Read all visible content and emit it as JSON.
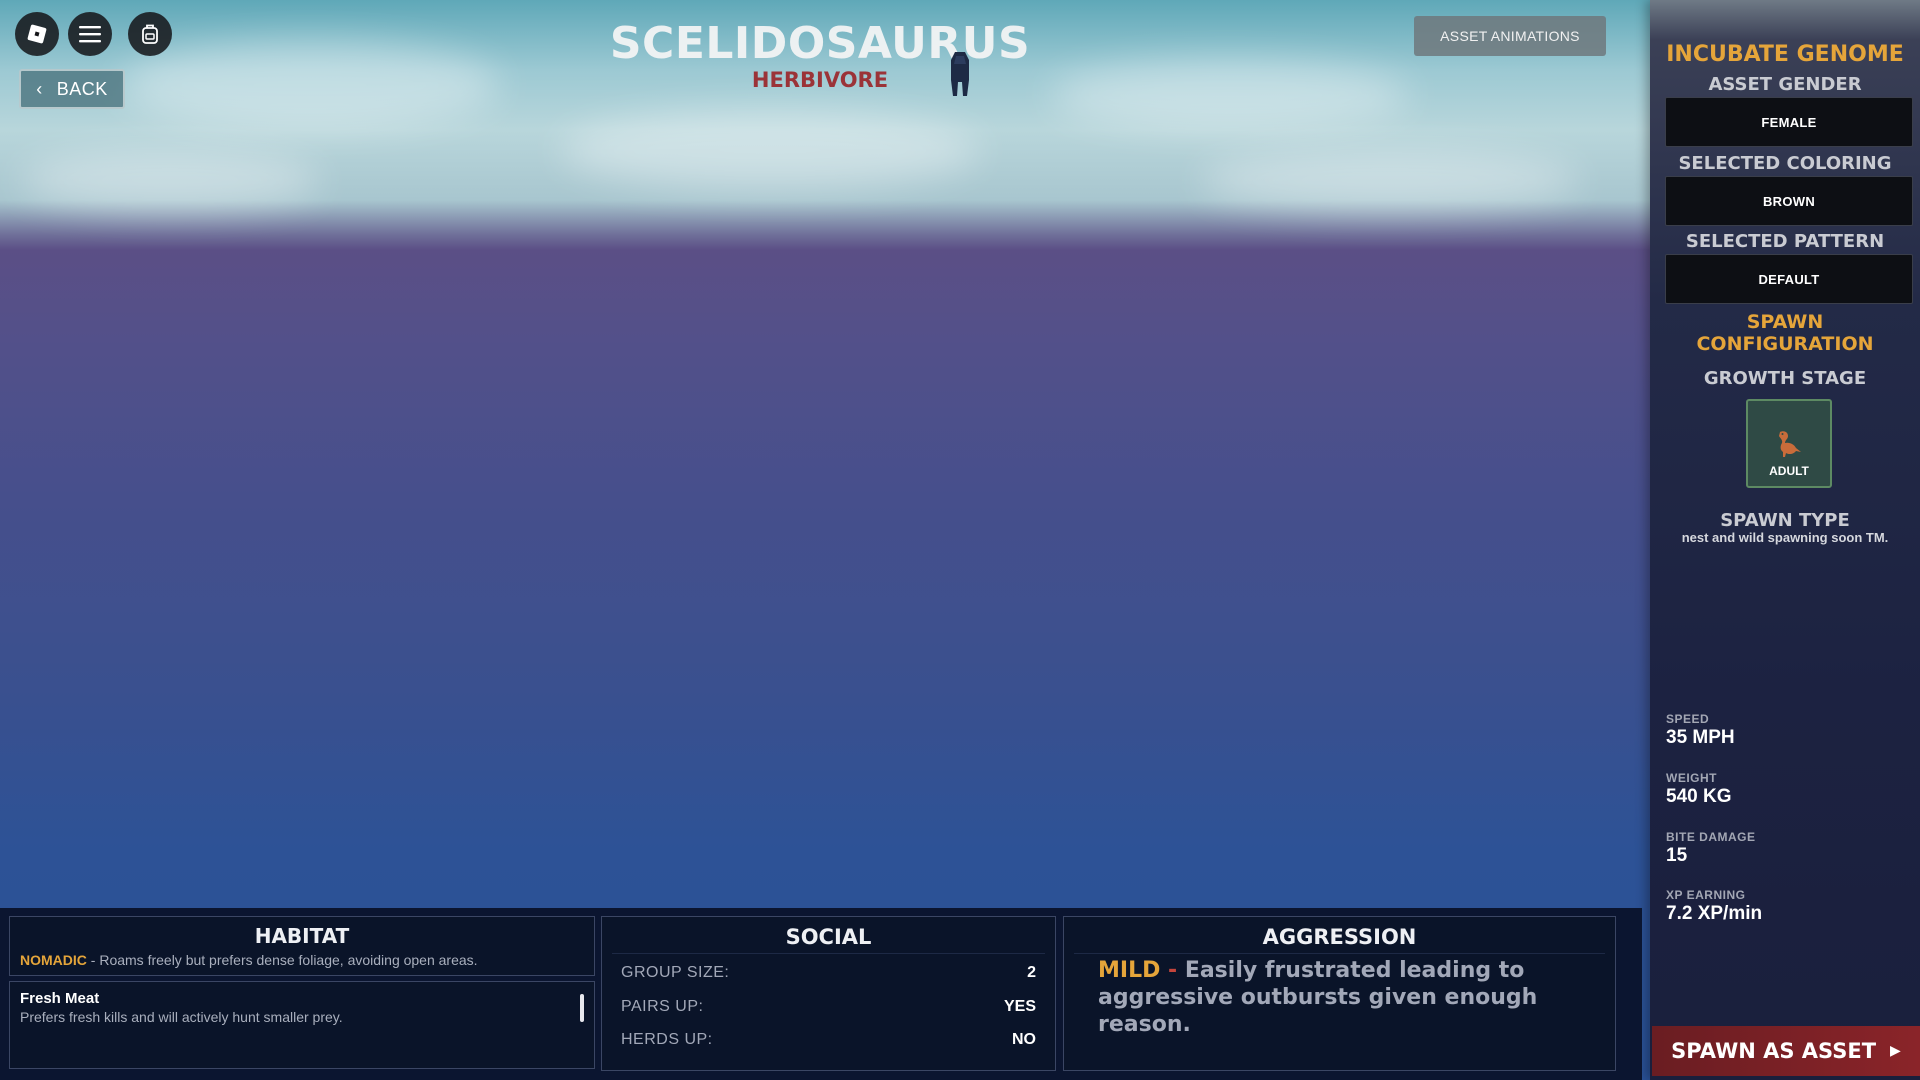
{
  "species": {
    "name": "SCELIDOSAURUS",
    "diet_class": "HERBIVORE"
  },
  "topbar": {
    "back_label": "BACK",
    "asset_animations_label": "ASSET ANIMATIONS"
  },
  "side_panel": {
    "title": "INCUBATE GENOME",
    "gender_label": "ASSET GENDER",
    "gender_value": "FEMALE",
    "coloring_label": "SELECTED COLORING",
    "coloring_value": "BROWN",
    "pattern_label": "SELECTED PATTERN",
    "pattern_value": "DEFAULT",
    "spawn_config_line1": "SPAWN",
    "spawn_config_line2": "CONFIGURATION",
    "growth_stage_label": "GROWTH STAGE",
    "growth_stage_value": "ADULT",
    "spawn_type_label": "SPAWN TYPE",
    "spawn_type_note": "nest and wild spawning soon TM.",
    "stats": [
      {
        "label": "SPEED",
        "value": "35 MPH"
      },
      {
        "label": "WEIGHT",
        "value": "540 KG"
      },
      {
        "label": "BITE DAMAGE",
        "value": "15"
      },
      {
        "label": "XP EARNING",
        "value": "7.2 XP/min"
      }
    ],
    "spawn_button": "SPAWN AS ASSET"
  },
  "habitat": {
    "title": "HABITAT",
    "type": "NOMADIC",
    "description": " - Roams freely but prefers dense foliage, avoiding open areas.",
    "diet_name": "Fresh Meat",
    "diet_description": "Prefers fresh kills and will actively hunt smaller prey."
  },
  "social": {
    "title": "SOCIAL",
    "rows": [
      {
        "label": "GROUP SIZE:",
        "value": "2"
      },
      {
        "label": "PAIRS UP:",
        "value": "YES"
      },
      {
        "label": "HERDS UP:",
        "value": "NO"
      }
    ]
  },
  "aggression": {
    "title": "AGGRESSION",
    "level": "MILD",
    "separator": " - ",
    "description": "Easily frustrated leading to aggressive outbursts given enough reason."
  },
  "colors": {
    "accent_gold": "#e5a53a",
    "diet_red": "#9b3338",
    "spawn_red": "#8a2429"
  }
}
